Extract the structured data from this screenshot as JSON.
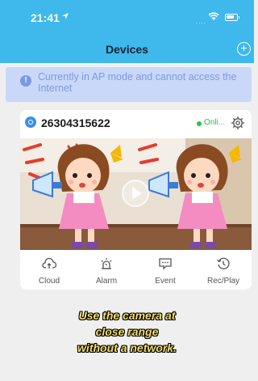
{
  "status_bar": {
    "time": "21:41",
    "signal": "....",
    "icons": [
      "location-arrow-icon",
      "wifi-icon",
      "battery-icon"
    ]
  },
  "nav": {
    "title": "Devices",
    "add_icon": "plus-circle-icon",
    "add_label": "+"
  },
  "notice": {
    "icon": "info-icon",
    "icon_label": "!",
    "text": "Currently in AP mode and cannot access the Internet",
    "color": "#7c99e6"
  },
  "device": {
    "icon": "camera-device-icon",
    "id": "26304315622",
    "status": "Onli...",
    "status_color": "#27c24c",
    "settings_icon": "gear-icon",
    "preview_icon": "play-icon",
    "actions": [
      {
        "label": "Cloud",
        "icon": "cloud-upload-icon"
      },
      {
        "label": "Alarm",
        "icon": "alarm-light-icon"
      },
      {
        "label": "Event",
        "icon": "event-message-icon"
      },
      {
        "label": "Rec/Play",
        "icon": "history-icon"
      }
    ]
  },
  "caption": {
    "lines": [
      "Use the camera at",
      "close range",
      "without a network."
    ],
    "color": "#f5df6a"
  },
  "colors": {
    "accent": "#3fb8ec",
    "background": "#efefef"
  }
}
